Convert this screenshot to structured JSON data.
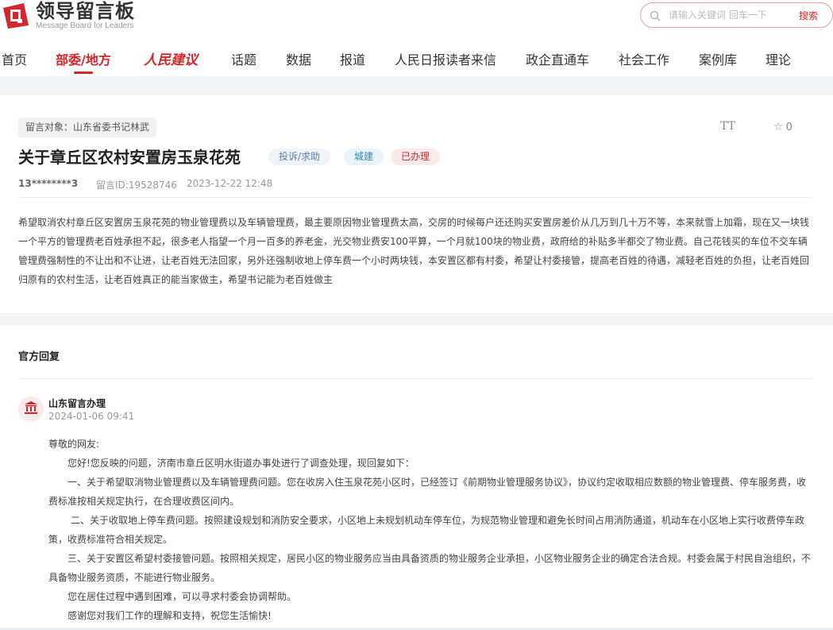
{
  "header": {
    "logo_title": "领导留言板",
    "logo_subtitle": "Message Board for Leaders",
    "search_placeholder": "请输入关键词 回车一下",
    "search_button": "搜索"
  },
  "nav": [
    {
      "label": "首页"
    },
    {
      "label": "部委/地方"
    },
    {
      "label": "人民建议"
    },
    {
      "label": "话题"
    },
    {
      "label": "数据"
    },
    {
      "label": "报道"
    },
    {
      "label": "人民日报读者来信"
    },
    {
      "label": "政企直通车"
    },
    {
      "label": "社会工作"
    },
    {
      "label": "案例库"
    },
    {
      "label": "理论"
    }
  ],
  "message": {
    "target": "留言对象：山东省委书记林武",
    "font_tool": "TT",
    "favorite_count": "0",
    "title": "关于章丘区农村安置房玉泉花苑",
    "badge_type": "投诉/求助",
    "badge_category": "城建",
    "badge_status": "已办理",
    "user": "13********3",
    "id": "留言ID:19528746",
    "time": "2023-12-22 12:48",
    "content": "希望取消农村章丘区安置房玉泉花苑的物业管理费以及车辆管理费，最主要原因物业管理费太高，交房的时候每户还还购买安置房差价从几万到几十万不等，本来就雪上加霜，现在又一块钱一个平方的管理费老百姓承担不起，很多老人指望一个月一百多的养老金，光交物业费安100平算，一个月就100块的物业费，政府给的补贴多半都交了物业费。自己花钱买的车位不交车辆管理费强制性的不让出和不让进，让老百姓无法回家，另外还强制收地上停车费一个小时两块钱，本安置区都有村委，希望让村委接管，提高老百姓的待遇，减轻老百姓的负担，让老百姓回归原有的农村生活，让老百姓真正的能当家做主，希望书记能为老百姓做主"
  },
  "reply": {
    "section_title": "官方回复",
    "org": "山东留言办理",
    "time": "2024-01-06 09:41",
    "greeting": "尊敬的网友:",
    "p1": "您好!您反映的问题，济南市章丘区明水街道办事处进行了调查处理，现回复如下：",
    "p2": "一、关于希望取消物业管理费以及车辆管理费问题。您在收房入住玉泉花苑小区时，已经签订《前期物业管理服务协议》，协议约定收取相应数额的物业管理费、停车服务费，收费标准按相关规定执行，在合理收费区间内。",
    "p3": "二、关于收取地上停车费问题。按照建设规划和消防安全要求，小区地上未规划机动车停车位，为规范物业管理和避免长时间占用消防通道，机动车在小区地上实行收费停车政策，收费标准符合相关规定。",
    "p4": "三、关于安置区希望村委接管问题。按照相关规定，居民小区的物业服务应当由具备资质的物业服务企业承担，小区物业服务企业的确定合法合规。村委会属于村民自治组织，不具备物业服务资质，不能进行物业服务。",
    "p5": "您在居住过程中遇到困难，可以寻求村委会协调帮助。",
    "p6": "感谢您对我们工作的理解和支持，祝您生活愉快!"
  },
  "colors": {
    "brand_red": "#d3272b",
    "band_gray": "#f4f5f7"
  },
  "icons": [
    "logo-mark-icon",
    "search-icon",
    "star-icon",
    "bank-icon"
  ]
}
